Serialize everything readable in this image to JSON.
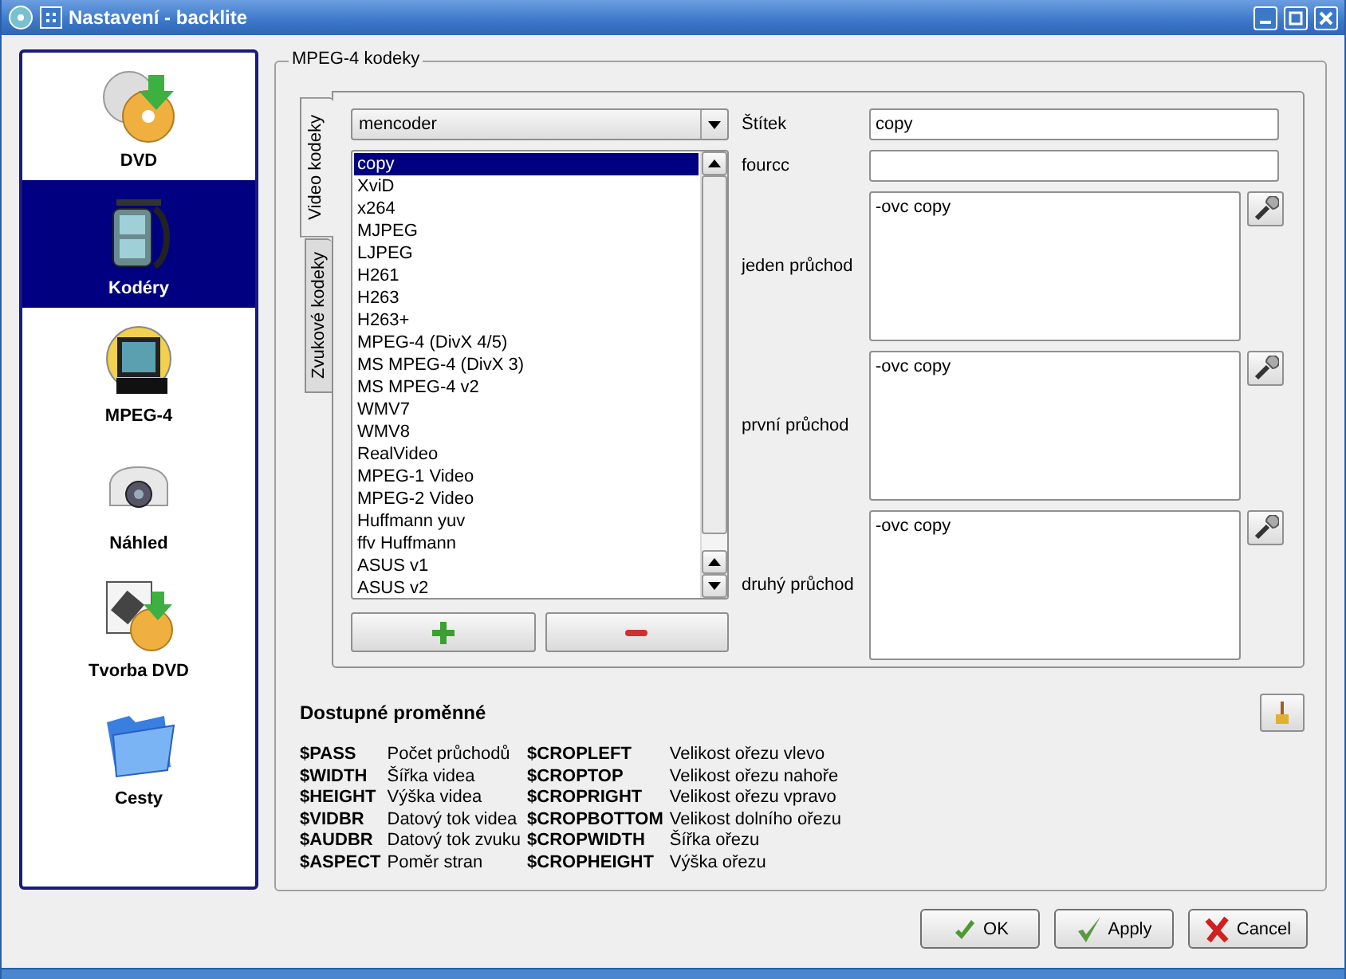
{
  "window": {
    "title": "Nastavení - backlite"
  },
  "sidebar": {
    "items": [
      {
        "label": "DVD",
        "kind": "dvd",
        "selected": false
      },
      {
        "label": "Kodéry",
        "kind": "encoder",
        "selected": true
      },
      {
        "label": "MPEG-4",
        "kind": "mpeg",
        "selected": false
      },
      {
        "label": "Náhled",
        "kind": "projector",
        "selected": false
      },
      {
        "label": "Tvorba DVD",
        "kind": "authoring",
        "selected": false
      },
      {
        "label": "Cesty",
        "kind": "folder",
        "selected": false
      }
    ]
  },
  "group": {
    "title": "MPEG-4 kodeky"
  },
  "tabs": [
    {
      "label": "Video kodeky",
      "selected": true
    },
    {
      "label": "Zvukové kodeky",
      "selected": false
    }
  ],
  "encoder_select": {
    "value": "mencoder"
  },
  "codecs": [
    {
      "label": "copy",
      "selected": true
    },
    {
      "label": "XviD",
      "selected": false
    },
    {
      "label": "x264",
      "selected": false
    },
    {
      "label": "MJPEG",
      "selected": false
    },
    {
      "label": "LJPEG",
      "selected": false
    },
    {
      "label": "H261",
      "selected": false
    },
    {
      "label": "H263",
      "selected": false
    },
    {
      "label": "H263+",
      "selected": false
    },
    {
      "label": "MPEG-4 (DivX 4/5)",
      "selected": false
    },
    {
      "label": "MS MPEG-4 (DivX 3)",
      "selected": false
    },
    {
      "label": "MS MPEG-4 v2",
      "selected": false
    },
    {
      "label": "WMV7",
      "selected": false
    },
    {
      "label": "WMV8",
      "selected": false
    },
    {
      "label": "RealVideo",
      "selected": false
    },
    {
      "label": "MPEG-1 Video",
      "selected": false
    },
    {
      "label": "MPEG-2 Video",
      "selected": false
    },
    {
      "label": "Huffmann yuv",
      "selected": false
    },
    {
      "label": "ffv Huffmann",
      "selected": false
    },
    {
      "label": "ASUS v1",
      "selected": false
    },
    {
      "label": "ASUS v2",
      "selected": false
    }
  ],
  "name_field": {
    "label": "Štítek",
    "value": "copy"
  },
  "fourcc_field": {
    "label": "fourcc"
  },
  "passes": [
    {
      "label": "jeden průchod",
      "value": "-ovc copy"
    },
    {
      "label": "první průchod",
      "value": "-ovc copy"
    },
    {
      "label": "druhý průchod",
      "value": "-ovc copy"
    }
  ],
  "variables": {
    "title": "Dostupné proměnné",
    "items": [
      {
        "name": "$PASS",
        "description": "Počet průchodů"
      },
      {
        "name": "$WIDTH",
        "description": "Šířka videa"
      },
      {
        "name": "$HEIGHT",
        "description": "Výška videa"
      },
      {
        "name": "$VIDBR",
        "description": "Datový tok videa"
      },
      {
        "name": "$AUDBR",
        "description": "Datový tok zvuku"
      },
      {
        "name": "$ASPECT",
        "description": "Poměr stran"
      },
      {
        "name": "$CROPLEFT",
        "description": "Velikost ořezu vlevo"
      },
      {
        "name": "$CROPTOP",
        "description": "Velikost ořezu nahoře"
      },
      {
        "name": "$CROPRIGHT",
        "description": "Velikost ořezu vpravo"
      },
      {
        "name": "$CROPBOTTOM",
        "description": "Velikost dolního ořezu"
      },
      {
        "name": "$CROPWIDTH",
        "description": "Šířka ořezu"
      },
      {
        "name": "$CROPHEIGHT",
        "description": "Výška ořezu"
      }
    ]
  },
  "buttons": [
    {
      "label": "OK",
      "kind": "ok"
    },
    {
      "label": "Apply",
      "kind": "apply"
    },
    {
      "label": "Cancel",
      "kind": "cancel"
    }
  ]
}
